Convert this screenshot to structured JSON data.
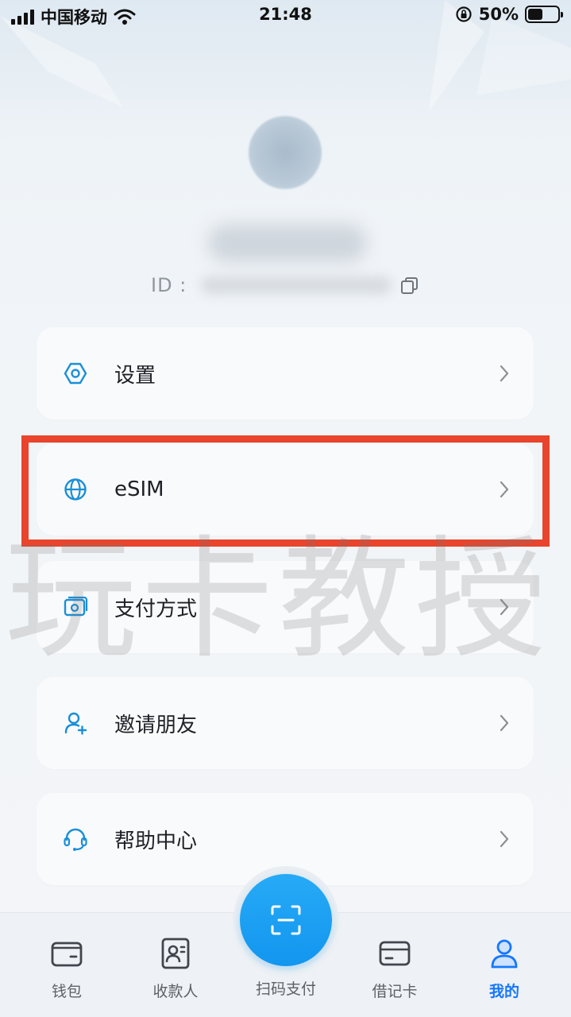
{
  "status_bar": {
    "carrier": "中国移动",
    "time": "21:48",
    "battery_percent_label": "50%",
    "battery_level": 0.5
  },
  "profile": {
    "id_label": "ID :"
  },
  "menu": {
    "items": [
      {
        "label": "设置",
        "icon": "settings-hexagon-icon"
      },
      {
        "label": "eSIM",
        "icon": "globe-icon"
      },
      {
        "label": "支付方式",
        "icon": "card-photo-icon"
      },
      {
        "label": "邀请朋友",
        "icon": "add-user-icon"
      },
      {
        "label": "帮助中心",
        "icon": "headset-icon"
      }
    ]
  },
  "watermark": "玩卡教授",
  "tabbar": {
    "wallet": "钱包",
    "payees": "收款人",
    "scan_pay": "扫码支付",
    "debit_card": "借记卡",
    "mine": "我的"
  },
  "colors": {
    "accent": "#1677ff",
    "scan_button": "#1296ef",
    "highlight_border": "#e9442c",
    "icon_stroke": "#1a8fd8"
  }
}
